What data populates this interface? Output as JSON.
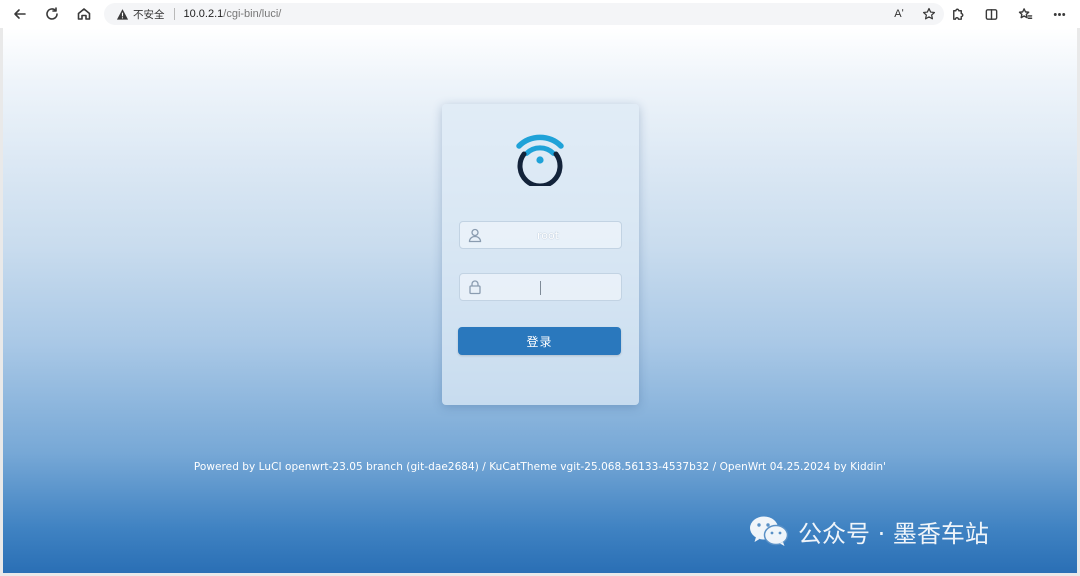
{
  "browser": {
    "security_label": "不安全",
    "url_host": "10.0.2.1",
    "url_path": "/cgi-bin/luci/",
    "read_aloud_label": "Aʹ"
  },
  "login": {
    "username_value": "root",
    "password_value": "",
    "submit_label": "登录"
  },
  "footer": {
    "text": "Powered by LuCI openwrt-23.05 branch (git-dae2684) / KuCatTheme vgit-25.068.56133-4537b32 / OpenWrt 04.25.2024 by Kiddin'"
  },
  "watermark": {
    "text": "公众号 · 墨香车站"
  },
  "colors": {
    "accent": "#2a78bd",
    "logo_blue": "#1fa2d8",
    "logo_dark": "#13233a"
  },
  "icons": {
    "back": "arrow-left-icon",
    "refresh": "refresh-icon",
    "home": "home-icon",
    "warning": "warning-icon",
    "favorite": "star-icon",
    "extensions": "puzzle-icon",
    "split": "split-screen-icon",
    "favorites": "favorites-icon",
    "more": "ellipsis-icon",
    "user": "user-icon",
    "lock": "lock-icon"
  }
}
